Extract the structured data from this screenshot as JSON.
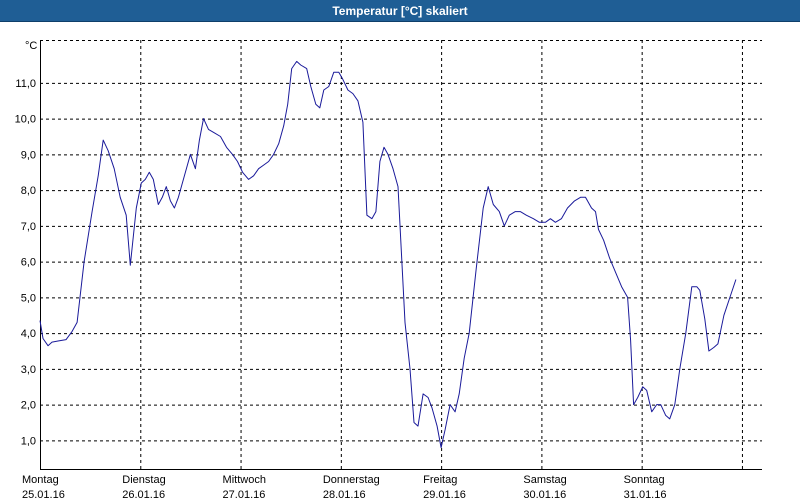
{
  "window": {
    "title": "Temperatur [°C] skaliert"
  },
  "colors": {
    "titlebar": "#1f5e95",
    "series": "#1a1a9a",
    "grid": "#000000",
    "background": "#ffffff"
  },
  "chart_data": {
    "type": "line",
    "title": "Temperatur [°C] skaliert",
    "ylabel": "°C",
    "ylim": [
      0.2,
      12.2
    ],
    "yticks": [
      1,
      2,
      3,
      4,
      5,
      6,
      7,
      8,
      9,
      10,
      11
    ],
    "ytick_labels": [
      "1,0",
      "2,0",
      "3,0",
      "4,0",
      "5,0",
      "6,0",
      "7,0",
      "8,0",
      "9,0",
      "10,0",
      "11,0"
    ],
    "xlim": [
      0,
      7.2
    ],
    "grid": true,
    "x_day_labels": [
      {
        "day": "Montag",
        "date": "25.01.16"
      },
      {
        "day": "Dienstag",
        "date": "26.01.16"
      },
      {
        "day": "Mittwoch",
        "date": "27.01.16"
      },
      {
        "day": "Donnerstag",
        "date": "28.01.16"
      },
      {
        "day": "Freitag",
        "date": "29.01.16"
      },
      {
        "day": "Samstag",
        "date": "30.01.16"
      },
      {
        "day": "Sonntag",
        "date": "31.01.16"
      }
    ],
    "series": [
      {
        "values": [
          [
            0.0,
            4.35
          ],
          [
            0.03,
            3.85
          ],
          [
            0.08,
            3.65
          ],
          [
            0.12,
            3.75
          ],
          [
            0.18,
            3.78
          ],
          [
            0.26,
            3.82
          ],
          [
            0.32,
            4.05
          ],
          [
            0.37,
            4.3
          ],
          [
            0.44,
            6.0
          ],
          [
            0.52,
            7.4
          ],
          [
            0.58,
            8.4
          ],
          [
            0.63,
            9.4
          ],
          [
            0.68,
            9.1
          ],
          [
            0.74,
            8.6
          ],
          [
            0.8,
            7.8
          ],
          [
            0.86,
            7.3
          ],
          [
            0.9,
            5.9
          ],
          [
            0.96,
            7.5
          ],
          [
            1.01,
            8.2
          ],
          [
            1.05,
            8.3
          ],
          [
            1.09,
            8.5
          ],
          [
            1.13,
            8.3
          ],
          [
            1.18,
            7.6
          ],
          [
            1.22,
            7.8
          ],
          [
            1.26,
            8.1
          ],
          [
            1.3,
            7.7
          ],
          [
            1.34,
            7.5
          ],
          [
            1.38,
            7.8
          ],
          [
            1.43,
            8.3
          ],
          [
            1.5,
            9.0
          ],
          [
            1.55,
            8.6
          ],
          [
            1.59,
            9.4
          ],
          [
            1.63,
            10.0
          ],
          [
            1.68,
            9.7
          ],
          [
            1.74,
            9.6
          ],
          [
            1.8,
            9.5
          ],
          [
            1.86,
            9.2
          ],
          [
            1.92,
            9.0
          ],
          [
            1.97,
            8.8
          ],
          [
            2.02,
            8.5
          ],
          [
            2.08,
            8.3
          ],
          [
            2.13,
            8.4
          ],
          [
            2.18,
            8.6
          ],
          [
            2.23,
            8.7
          ],
          [
            2.28,
            8.8
          ],
          [
            2.33,
            9.0
          ],
          [
            2.38,
            9.3
          ],
          [
            2.43,
            9.8
          ],
          [
            2.47,
            10.4
          ],
          [
            2.51,
            11.4
          ],
          [
            2.56,
            11.6
          ],
          [
            2.6,
            11.5
          ],
          [
            2.66,
            11.4
          ],
          [
            2.7,
            10.9
          ],
          [
            2.75,
            10.4
          ],
          [
            2.79,
            10.3
          ],
          [
            2.83,
            10.8
          ],
          [
            2.88,
            10.9
          ],
          [
            2.93,
            11.3
          ],
          [
            2.98,
            11.3
          ],
          [
            3.02,
            11.1
          ],
          [
            3.07,
            10.8
          ],
          [
            3.12,
            10.7
          ],
          [
            3.17,
            10.5
          ],
          [
            3.22,
            9.9
          ],
          [
            3.26,
            7.3
          ],
          [
            3.31,
            7.2
          ],
          [
            3.35,
            7.4
          ],
          [
            3.39,
            8.8
          ],
          [
            3.43,
            9.2
          ],
          [
            3.47,
            9.0
          ],
          [
            3.52,
            8.6
          ],
          [
            3.57,
            8.1
          ],
          [
            3.64,
            4.3
          ],
          [
            3.69,
            3.0
          ],
          [
            3.73,
            1.5
          ],
          [
            3.77,
            1.4
          ],
          [
            3.82,
            2.3
          ],
          [
            3.87,
            2.2
          ],
          [
            3.91,
            1.9
          ],
          [
            3.96,
            1.4
          ],
          [
            4.0,
            0.8
          ],
          [
            4.04,
            1.3
          ],
          [
            4.09,
            2.0
          ],
          [
            4.14,
            1.8
          ],
          [
            4.18,
            2.3
          ],
          [
            4.23,
            3.3
          ],
          [
            4.28,
            4.0
          ],
          [
            4.35,
            5.8
          ],
          [
            4.42,
            7.5
          ],
          [
            4.47,
            8.1
          ],
          [
            4.52,
            7.6
          ],
          [
            4.58,
            7.4
          ],
          [
            4.63,
            7.0
          ],
          [
            4.68,
            7.3
          ],
          [
            4.74,
            7.4
          ],
          [
            4.79,
            7.4
          ],
          [
            4.85,
            7.3
          ],
          [
            4.92,
            7.2
          ],
          [
            4.98,
            7.1
          ],
          [
            5.04,
            7.1
          ],
          [
            5.09,
            7.2
          ],
          [
            5.14,
            7.1
          ],
          [
            5.2,
            7.2
          ],
          [
            5.26,
            7.5
          ],
          [
            5.33,
            7.7
          ],
          [
            5.39,
            7.8
          ],
          [
            5.44,
            7.8
          ],
          [
            5.5,
            7.5
          ],
          [
            5.54,
            7.4
          ],
          [
            5.57,
            6.9
          ],
          [
            5.62,
            6.6
          ],
          [
            5.68,
            6.1
          ],
          [
            5.74,
            5.7
          ],
          [
            5.8,
            5.3
          ],
          [
            5.86,
            5.0
          ],
          [
            5.89,
            3.8
          ],
          [
            5.92,
            2.0
          ],
          [
            5.96,
            2.2
          ],
          [
            6.01,
            2.5
          ],
          [
            6.05,
            2.4
          ],
          [
            6.1,
            1.8
          ],
          [
            6.15,
            2.0
          ],
          [
            6.19,
            2.0
          ],
          [
            6.24,
            1.7
          ],
          [
            6.28,
            1.6
          ],
          [
            6.33,
            2.0
          ],
          [
            6.38,
            3.0
          ],
          [
            6.44,
            4.0
          ],
          [
            6.5,
            5.3
          ],
          [
            6.55,
            5.3
          ],
          [
            6.58,
            5.2
          ],
          [
            6.63,
            4.4
          ],
          [
            6.67,
            3.5
          ],
          [
            6.72,
            3.6
          ],
          [
            6.76,
            3.7
          ],
          [
            6.82,
            4.5
          ],
          [
            6.88,
            5.0
          ],
          [
            6.94,
            5.5
          ]
        ]
      }
    ]
  }
}
